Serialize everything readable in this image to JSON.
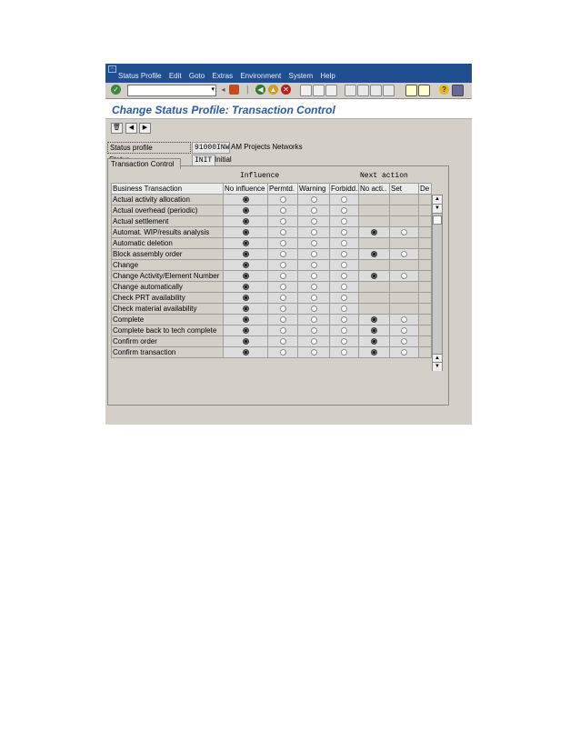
{
  "menubar": {
    "items": [
      "Status Profile",
      "Edit",
      "Goto",
      "Extras",
      "Environment",
      "System",
      "Help"
    ]
  },
  "title": "Change Status Profile: Transaction Control",
  "header": {
    "status_profile_label": "Status profile",
    "status_profile_value": "91000INW",
    "status_profile_text": "AM Projects Networks",
    "status_label": "Status",
    "status_value": "INIT",
    "status_text": "Initial"
  },
  "group": {
    "title": "Transaction Control",
    "influence_label": "Influence",
    "next_action_label": "Next action"
  },
  "columns": [
    "Business Transaction",
    "No influence",
    "Permtd.",
    "Warning",
    "Forbidd.",
    "No acti..",
    "Set",
    "De"
  ],
  "rows": [
    {
      "name": "Actual activity allocation",
      "influence": 0,
      "next": null
    },
    {
      "name": "Actual overhead (periodic)",
      "influence": 0,
      "next": null
    },
    {
      "name": "Actual settlement",
      "influence": 0,
      "next": null
    },
    {
      "name": "Automat. WIP/results analysis",
      "influence": 0,
      "next": 0
    },
    {
      "name": "Automatic deletion",
      "influence": 0,
      "next": null
    },
    {
      "name": "Block assembly order",
      "influence": 0,
      "next": 0
    },
    {
      "name": "Change",
      "influence": 0,
      "next": null
    },
    {
      "name": "Change Activity/Element Number",
      "influence": 0,
      "next": 0
    },
    {
      "name": "Change automatically",
      "influence": 0,
      "next": null
    },
    {
      "name": "Check PRT availability",
      "influence": 0,
      "next": null
    },
    {
      "name": "Check material availability",
      "influence": 0,
      "next": null
    },
    {
      "name": "Complete",
      "influence": 0,
      "next": 0
    },
    {
      "name": "Complete back to tech complete",
      "influence": 0,
      "next": 0
    },
    {
      "name": "Confirm order",
      "influence": 0,
      "next": 0
    },
    {
      "name": "Confirm transaction",
      "influence": 0,
      "next": 0
    }
  ],
  "colors": {
    "menubar_bg": "#1f4f8f",
    "title_color": "#2a5aa0",
    "frame_bg": "#a7bac7",
    "panel_bg": "#d4d0c8"
  },
  "icons": [
    "enter-icon",
    "save-icon",
    "back-icon",
    "exit-icon",
    "cancel-icon",
    "print-icon",
    "find-icon",
    "help-icon",
    "delete-icon",
    "previous-icon",
    "next-icon"
  ]
}
